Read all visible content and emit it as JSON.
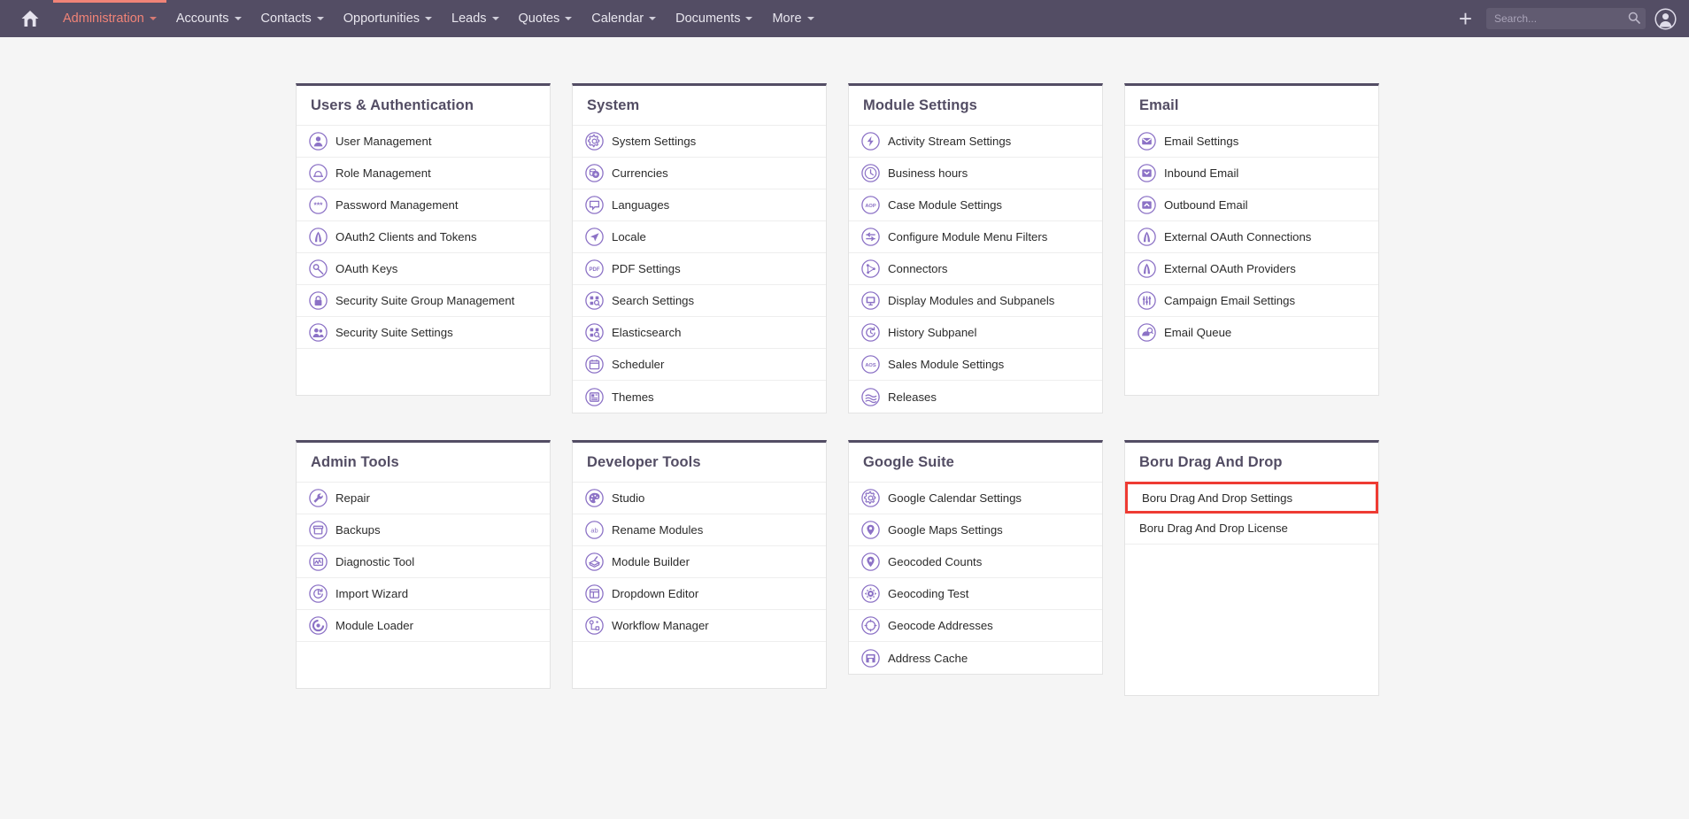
{
  "colors": {
    "navbar_bg": "#534d64",
    "active_nav": "#f08377",
    "icon_purple": "#8c72c6",
    "panel_top_border": "#534d64",
    "highlight_red": "#ee3b33"
  },
  "navbar": {
    "home_icon": "home-icon",
    "items": [
      {
        "label": "Administration",
        "has_caret": true,
        "active": true
      },
      {
        "label": "Accounts",
        "has_caret": true,
        "active": false
      },
      {
        "label": "Contacts",
        "has_caret": true,
        "active": false
      },
      {
        "label": "Opportunities",
        "has_caret": true,
        "active": false
      },
      {
        "label": "Leads",
        "has_caret": true,
        "active": false
      },
      {
        "label": "Quotes",
        "has_caret": true,
        "active": false
      },
      {
        "label": "Calendar",
        "has_caret": true,
        "active": false
      },
      {
        "label": "Documents",
        "has_caret": true,
        "active": false
      },
      {
        "label": "More",
        "has_caret": true,
        "active": false
      }
    ],
    "plus_label": "+",
    "search": {
      "placeholder": "Search...",
      "value": "",
      "icon": "search-icon"
    },
    "avatar_icon": "user-avatar-icon"
  },
  "panels": [
    {
      "id": "users-authentication",
      "title": "Users & Authentication",
      "filler": true,
      "items": [
        {
          "label": "User Management",
          "icon": "user-icon"
        },
        {
          "label": "Role Management",
          "icon": "role-hat-icon"
        },
        {
          "label": "Password Management",
          "icon": "asterisks-icon"
        },
        {
          "label": "OAuth2 Clients and Tokens",
          "icon": "oauth-a-icon"
        },
        {
          "label": "OAuth Keys",
          "icon": "key-icon"
        },
        {
          "label": "Security Suite Group Management",
          "icon": "lock-icon"
        },
        {
          "label": "Security Suite Settings",
          "icon": "group-users-icon"
        }
      ]
    },
    {
      "id": "system",
      "title": "System",
      "filler": false,
      "items": [
        {
          "label": "System Settings",
          "icon": "gear-icon"
        },
        {
          "label": "Currencies",
          "icon": "coins-icon"
        },
        {
          "label": "Languages",
          "icon": "speech-bubble-icon"
        },
        {
          "label": "Locale",
          "icon": "navigation-arrow-icon"
        },
        {
          "label": "PDF Settings",
          "icon": "pdf-icon"
        },
        {
          "label": "Search Settings",
          "icon": "search-grid-icon"
        },
        {
          "label": "Elasticsearch",
          "icon": "search-grid-icon"
        },
        {
          "label": "Scheduler",
          "icon": "calendar-icon"
        },
        {
          "label": "Themes",
          "icon": "themes-icon"
        }
      ]
    },
    {
      "id": "module-settings",
      "title": "Module Settings",
      "filler": false,
      "items": [
        {
          "label": "Activity Stream Settings",
          "icon": "bolt-icon"
        },
        {
          "label": "Business hours",
          "icon": "clock-icon"
        },
        {
          "label": "Case Module Settings",
          "icon": "aop-icon"
        },
        {
          "label": "Configure Module Menu Filters",
          "icon": "sliders-icon"
        },
        {
          "label": "Connectors",
          "icon": "connectors-icon"
        },
        {
          "label": "Display Modules and Subpanels",
          "icon": "monitor-icon"
        },
        {
          "label": "History Subpanel",
          "icon": "history-icon"
        },
        {
          "label": "Sales Module Settings",
          "icon": "aos-icon"
        },
        {
          "label": "Releases",
          "icon": "releases-icon"
        }
      ]
    },
    {
      "id": "email",
      "title": "Email",
      "filler": true,
      "items": [
        {
          "label": "Email Settings",
          "icon": "envelope-icon"
        },
        {
          "label": "Inbound Email",
          "icon": "inbound-email-icon"
        },
        {
          "label": "Outbound Email",
          "icon": "outbound-email-icon"
        },
        {
          "label": "External OAuth Connections",
          "icon": "oauth-a-icon"
        },
        {
          "label": "External OAuth Providers",
          "icon": "oauth-a-icon"
        },
        {
          "label": "Campaign Email Settings",
          "icon": "equalizer-icon"
        },
        {
          "label": "Email Queue",
          "icon": "email-queue-icon"
        }
      ]
    },
    {
      "id": "admin-tools",
      "title": "Admin Tools",
      "filler": true,
      "items": [
        {
          "label": "Repair",
          "icon": "wrench-icon"
        },
        {
          "label": "Backups",
          "icon": "backup-box-icon"
        },
        {
          "label": "Diagnostic Tool",
          "icon": "diagnostic-chart-icon"
        },
        {
          "label": "Import Wizard",
          "icon": "import-icon"
        },
        {
          "label": "Module Loader",
          "icon": "module-loader-icon"
        }
      ]
    },
    {
      "id": "developer-tools",
      "title": "Developer Tools",
      "filler": true,
      "items": [
        {
          "label": "Studio",
          "icon": "palette-icon"
        },
        {
          "label": "Rename Modules",
          "icon": "ab-icon"
        },
        {
          "label": "Module Builder",
          "icon": "module-builder-icon"
        },
        {
          "label": "Dropdown Editor",
          "icon": "dropdown-editor-icon"
        },
        {
          "label": "Workflow Manager",
          "icon": "workflow-icon"
        }
      ]
    },
    {
      "id": "google-suite",
      "title": "Google Suite",
      "filler": false,
      "items": [
        {
          "label": "Google Calendar Settings",
          "icon": "gear-icon"
        },
        {
          "label": "Google Maps Settings",
          "icon": "map-pin-icon"
        },
        {
          "label": "Geocoded Counts",
          "icon": "map-pin-star-icon"
        },
        {
          "label": "Geocoding Test",
          "icon": "geocoding-test-icon"
        },
        {
          "label": "Geocode Addresses",
          "icon": "target-icon"
        },
        {
          "label": "Address Cache",
          "icon": "address-cache-icon"
        }
      ]
    },
    {
      "id": "boru-drag-and-drop",
      "title": "Boru Drag And Drop",
      "filler": true,
      "filler_height": 170,
      "items": [
        {
          "label": "Boru Drag And Drop Settings",
          "icon": null,
          "highlighted": true
        },
        {
          "label": "Boru Drag And Drop License",
          "icon": null,
          "highlighted": false
        }
      ]
    }
  ]
}
